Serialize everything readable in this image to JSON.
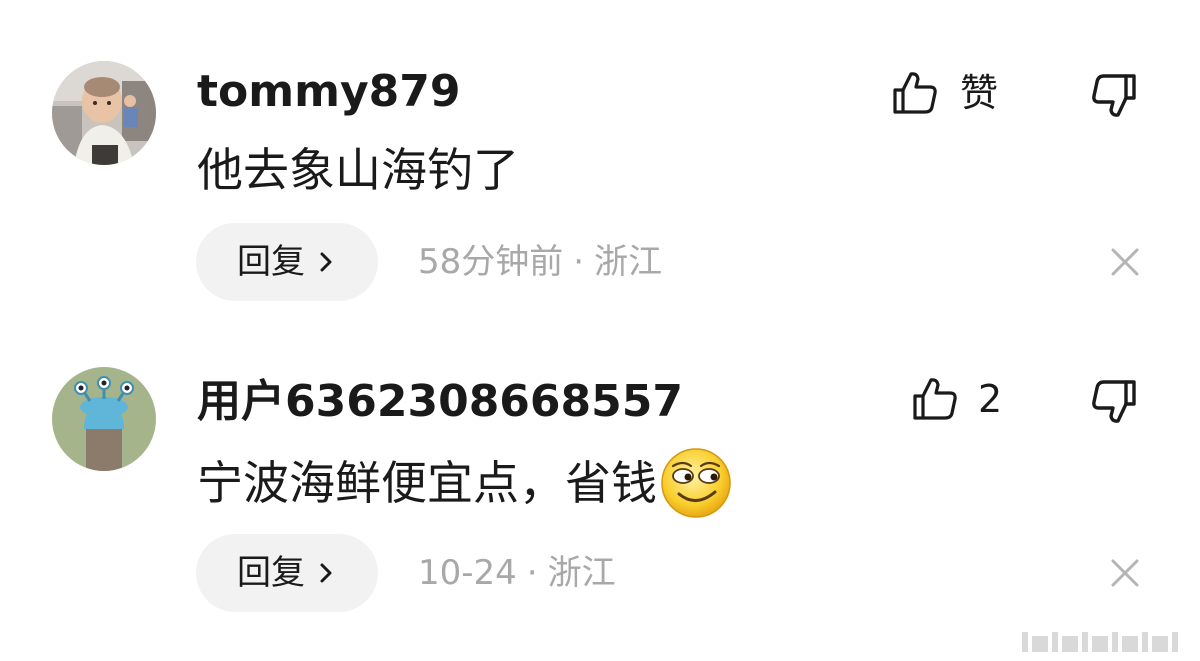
{
  "comments": [
    {
      "username": "tommy879",
      "content": "他去象山海钓了",
      "like_label": "赞",
      "reply_label": "回复",
      "time": "58分钟前",
      "separator": "·",
      "location": "浙江",
      "avatar_icon": "baby-photo-avatar",
      "like_icon": "thumbs-up-icon",
      "dislike_icon": "thumbs-down-icon",
      "close_icon": "close-icon"
    },
    {
      "username": "用户6362308668557",
      "content": "宁波海鲜便宜点，省钱",
      "emoji": "smirk-emoji",
      "like_label": "2",
      "reply_label": "回复",
      "time": "10-24",
      "separator": "·",
      "location": "浙江",
      "avatar_icon": "cartoon-alien-avatar",
      "like_icon": "thumbs-up-icon",
      "dislike_icon": "thumbs-down-icon",
      "close_icon": "close-icon"
    }
  ],
  "colors": {
    "text": "#1a1a1a",
    "meta": "#a8a8a8",
    "reply_bg": "#f2f2f2",
    "icon": "#1a1a1a",
    "close": "#b5b5b5"
  }
}
